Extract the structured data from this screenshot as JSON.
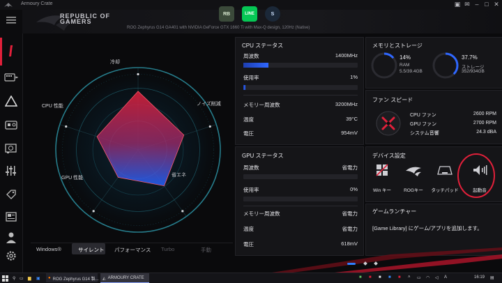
{
  "window": {
    "title": "Armoury Crate"
  },
  "header": {
    "logo_line1": "REPUBLIC OF",
    "logo_line2": "GAMERS",
    "model_text": "ROG Zephyrus G14 GA401 with NVIDIA GeForce GTX 1660 Ti with Max-Q design, 120Hz (Native)",
    "apps": [
      {
        "name": "ASUS",
        "label": "RB"
      },
      {
        "name": "LINE",
        "label": "LINE"
      },
      {
        "name": "Steam",
        "label": "S"
      }
    ]
  },
  "radar": {
    "axes": [
      "冷却",
      "ノイズ削減",
      "省エネ",
      "GPU 性能",
      "CPU 性能"
    ],
    "values": [
      0.95,
      0.78,
      0.72,
      0.55,
      0.7
    ]
  },
  "modes": {
    "items": [
      "Windows®",
      "サイレント",
      "パフォーマンス",
      "Turbo",
      "手動"
    ],
    "active": 1
  },
  "cpu": {
    "title": "CPU ステータス",
    "freq_label": "周波数",
    "freq_value": "1400MHz",
    "freq_fill": 0.22,
    "usage_label": "使用率",
    "usage_value": "1%",
    "usage_fill": 0.01,
    "mem_label": "メモリー周波数",
    "mem_value": "3200MHz",
    "temp_label": "温度",
    "temp_value": "39°C",
    "volt_label": "電圧",
    "volt_value": "954mV"
  },
  "gpu": {
    "title": "GPU ステータス",
    "freq_label": "周波数",
    "freq_value": "省電力",
    "usage_label": "使用率",
    "usage_value": "0%",
    "mem_label": "メモリー周波数",
    "mem_value": "省電力",
    "temp_label": "温度",
    "temp_value": "省電力",
    "volt_label": "電圧",
    "volt_value": "618mV"
  },
  "memory": {
    "title": "メモリとストレージ",
    "ram_percent": "14%",
    "ram_label": "RAM",
    "ram_detail": "5.5/39.4GB",
    "ram_fill": 0.14,
    "storage_percent": "37.7%",
    "storage_label": "ストレージ",
    "storage_detail": "352/934GB",
    "storage_fill": 0.377
  },
  "fan": {
    "title": "ファン スピード",
    "cpu_label": "CPU ファン",
    "cpu_value": "2600 RPM",
    "gpu_label": "GPU ファン",
    "gpu_value": "2700 RPM",
    "noise_label": "システム音響",
    "noise_value": "24.3 dBA"
  },
  "devices": {
    "title": "デバイス設定",
    "items": [
      "Win キー",
      "ROGキー",
      "タッチパッド",
      "起動音"
    ]
  },
  "launcher": {
    "title": "ゲームランチャー",
    "message": "[Game Library] にゲーム/アプリを追加します。"
  },
  "taskbar": {
    "task1": "ROG Zephyrus G14 製...",
    "task2": "ARMOURY CRATE",
    "clock": "16:19"
  },
  "colors": {
    "accent_red": "#e0203a",
    "accent_blue": "#2f67ff",
    "panel": "#151518"
  }
}
